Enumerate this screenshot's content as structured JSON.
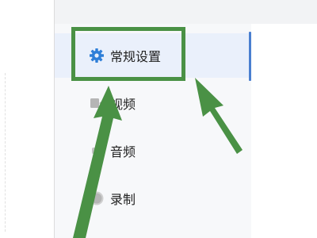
{
  "sidebar": {
    "items": [
      {
        "label": "常规设置",
        "icon": "gear-icon",
        "active": true
      },
      {
        "label": "视频",
        "icon": "video-icon",
        "active": false
      },
      {
        "label": "音频",
        "icon": "audio-icon",
        "active": false
      },
      {
        "label": "录制",
        "icon": "record-icon",
        "active": false
      }
    ]
  },
  "colors": {
    "accent": "#2f7fd8",
    "highlight_green": "#4a9145",
    "active_bg": "#eaf0fb",
    "sidebar_bg": "#f7f8fa"
  }
}
